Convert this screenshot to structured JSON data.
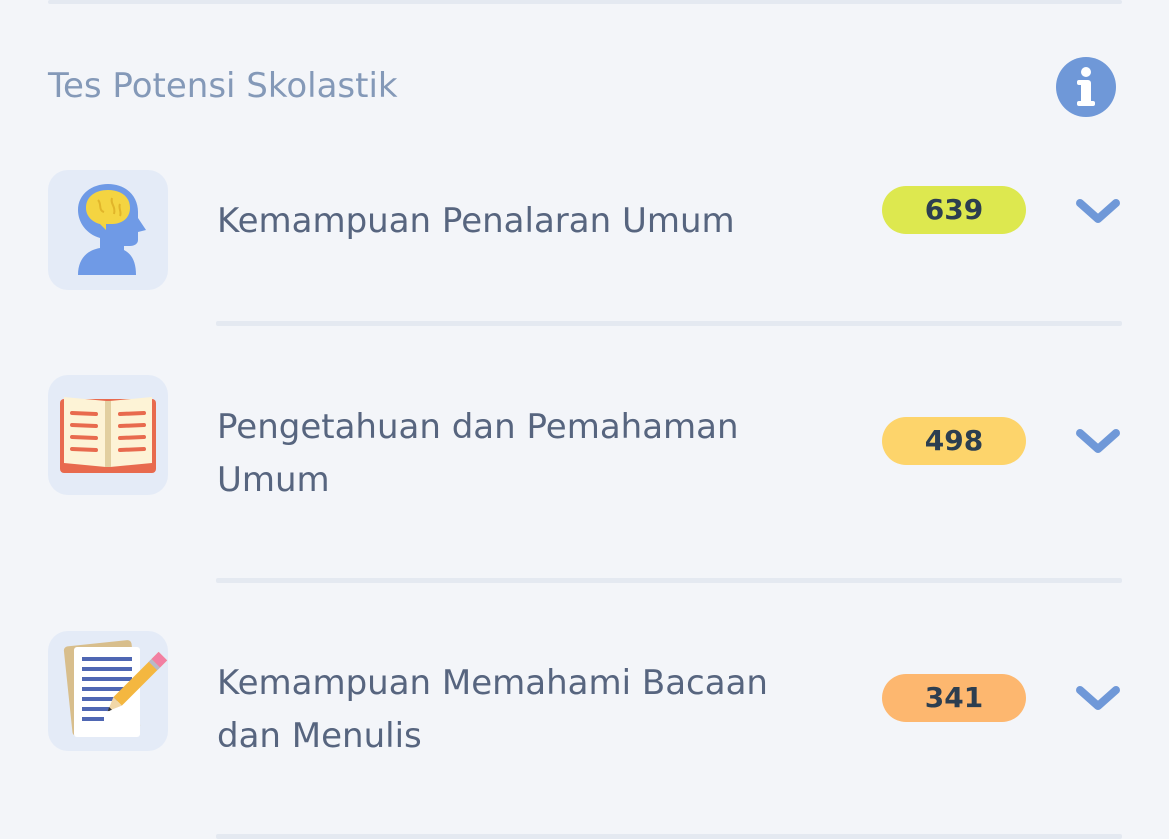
{
  "section": {
    "title": "Tes Potensi Skolastik",
    "info_icon": "info-icon"
  },
  "subtests": [
    {
      "label": "Kemampuan Penalaran Umum",
      "score": "639",
      "badge_color": "#dde84f",
      "icon": "brain-head-icon"
    },
    {
      "label": "Pengetahuan dan Pemahaman Umum",
      "score": "498",
      "badge_color": "#fdd46b",
      "icon": "open-book-icon"
    },
    {
      "label": "Kemampuan Memahami Bacaan dan Menulis",
      "score": "341",
      "badge_color": "#fdb76f",
      "icon": "document-pencil-icon"
    }
  ],
  "colors": {
    "background": "#f3f5f9",
    "accent": "#6f98d8",
    "label_text": "#57657f",
    "title_text": "#8499b8"
  }
}
